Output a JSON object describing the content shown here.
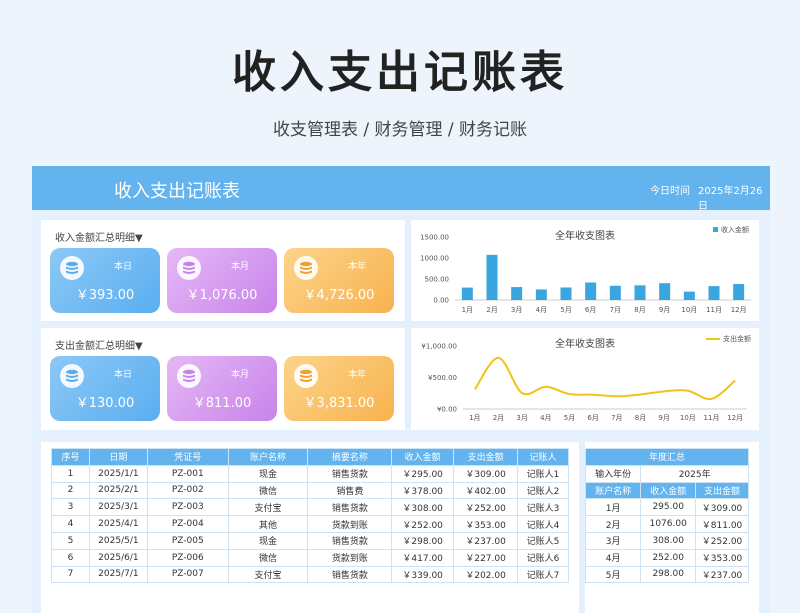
{
  "page": {
    "title": "收入支出记账表",
    "subtitle": "收支管理表 / 财务管理 / 财务记账"
  },
  "header": {
    "app_title": "收入支出记账表",
    "date_label": "今日时间",
    "date_value": "2025年2月26日"
  },
  "income_summary": {
    "heading": "收入金额汇总明细▼",
    "cards": [
      {
        "label": "本日",
        "amount": "￥393.00",
        "icon": "coin-stack-icon"
      },
      {
        "label": "本月",
        "amount": "￥1,076.00",
        "icon": "coin-stack-icon"
      },
      {
        "label": "本年",
        "amount": "￥4,726.00",
        "icon": "coin-stack-icon"
      }
    ]
  },
  "expense_summary": {
    "heading": "支出金额汇总明细▼",
    "cards": [
      {
        "label": "本日",
        "amount": "￥130.00",
        "icon": "coin-stack-icon"
      },
      {
        "label": "本月",
        "amount": "￥811.00",
        "icon": "coin-stack-icon"
      },
      {
        "label": "本年",
        "amount": "￥3,831.00",
        "icon": "coin-stack-icon"
      }
    ]
  },
  "colors": {
    "accent": "#62b3ee",
    "bar": "#3aa6e0",
    "line": "#f2c21a",
    "card_blue": "#5aaef0",
    "card_purple": "#c884ea",
    "card_orange": "#f8b24f"
  },
  "chart_data": [
    {
      "type": "bar",
      "title": "全年收支图表",
      "categories": [
        "1月",
        "2月",
        "3月",
        "4月",
        "5月",
        "6月",
        "7月",
        "8月",
        "9月",
        "10月",
        "11月",
        "12月"
      ],
      "series": [
        {
          "name": "收入金额",
          "values": [
            295,
            1076,
            308,
            252,
            298,
            417,
            339,
            350,
            400,
            200,
            330,
            380
          ]
        }
      ],
      "ylim": [
        0,
        1500
      ],
      "yticks": [
        "0.00",
        "500.00",
        "1000.00",
        "1500.00"
      ],
      "legend": "top-right",
      "grid": false
    },
    {
      "type": "line",
      "title": "全年收支图表",
      "categories": [
        "1月",
        "2月",
        "3月",
        "4月",
        "5月",
        "6月",
        "7月",
        "8月",
        "9月",
        "10月",
        "11月",
        "12月"
      ],
      "series": [
        {
          "name": "支出金额",
          "values": [
            309,
            811,
            252,
            353,
            237,
            227,
            202,
            230,
            280,
            290,
            160,
            452
          ]
        }
      ],
      "ylim": [
        0,
        1000
      ],
      "yticks": [
        "¥0.00",
        "¥500.00",
        "¥1,000.00"
      ],
      "legend": "top-right",
      "grid": false,
      "smooth": true
    }
  ],
  "ledger": {
    "headers": [
      "序号",
      "日期",
      "凭证号",
      "账户名称",
      "摘要名称",
      "收入金额",
      "支出金额",
      "记账人"
    ],
    "rows": [
      [
        "1",
        "2025/1/1",
        "PZ-001",
        "现金",
        "销售货款",
        "￥295.00",
        "￥309.00",
        "记账人1"
      ],
      [
        "2",
        "2025/2/1",
        "PZ-002",
        "微信",
        "销售费",
        "￥378.00",
        "￥402.00",
        "记账人2"
      ],
      [
        "3",
        "2025/3/1",
        "PZ-003",
        "支付宝",
        "销售货款",
        "￥308.00",
        "￥252.00",
        "记账人3"
      ],
      [
        "4",
        "2025/4/1",
        "PZ-004",
        "其他",
        "货款到账",
        "￥252.00",
        "￥353.00",
        "记账人4"
      ],
      [
        "5",
        "2025/5/1",
        "PZ-005",
        "现金",
        "销售货款",
        "￥298.00",
        "￥237.00",
        "记账人5"
      ],
      [
        "6",
        "2025/6/1",
        "PZ-006",
        "微信",
        "货款到账",
        "￥417.00",
        "￥227.00",
        "记账人6"
      ],
      [
        "7",
        "2025/7/1",
        "PZ-007",
        "支付宝",
        "销售货款",
        "￥339.00",
        "￥202.00",
        "记账人7"
      ]
    ]
  },
  "annual": {
    "title": "年度汇总",
    "year_label": "输入年份",
    "year_value": "2025年",
    "headers": [
      "账户名称",
      "收入金额",
      "支出金额"
    ],
    "rows": [
      [
        "1月",
        "295.00",
        "￥309.00"
      ],
      [
        "2月",
        "1076.00",
        "￥811.00"
      ],
      [
        "3月",
        "308.00",
        "￥252.00"
      ],
      [
        "4月",
        "252.00",
        "￥353.00"
      ],
      [
        "5月",
        "298.00",
        "￥237.00"
      ]
    ]
  }
}
